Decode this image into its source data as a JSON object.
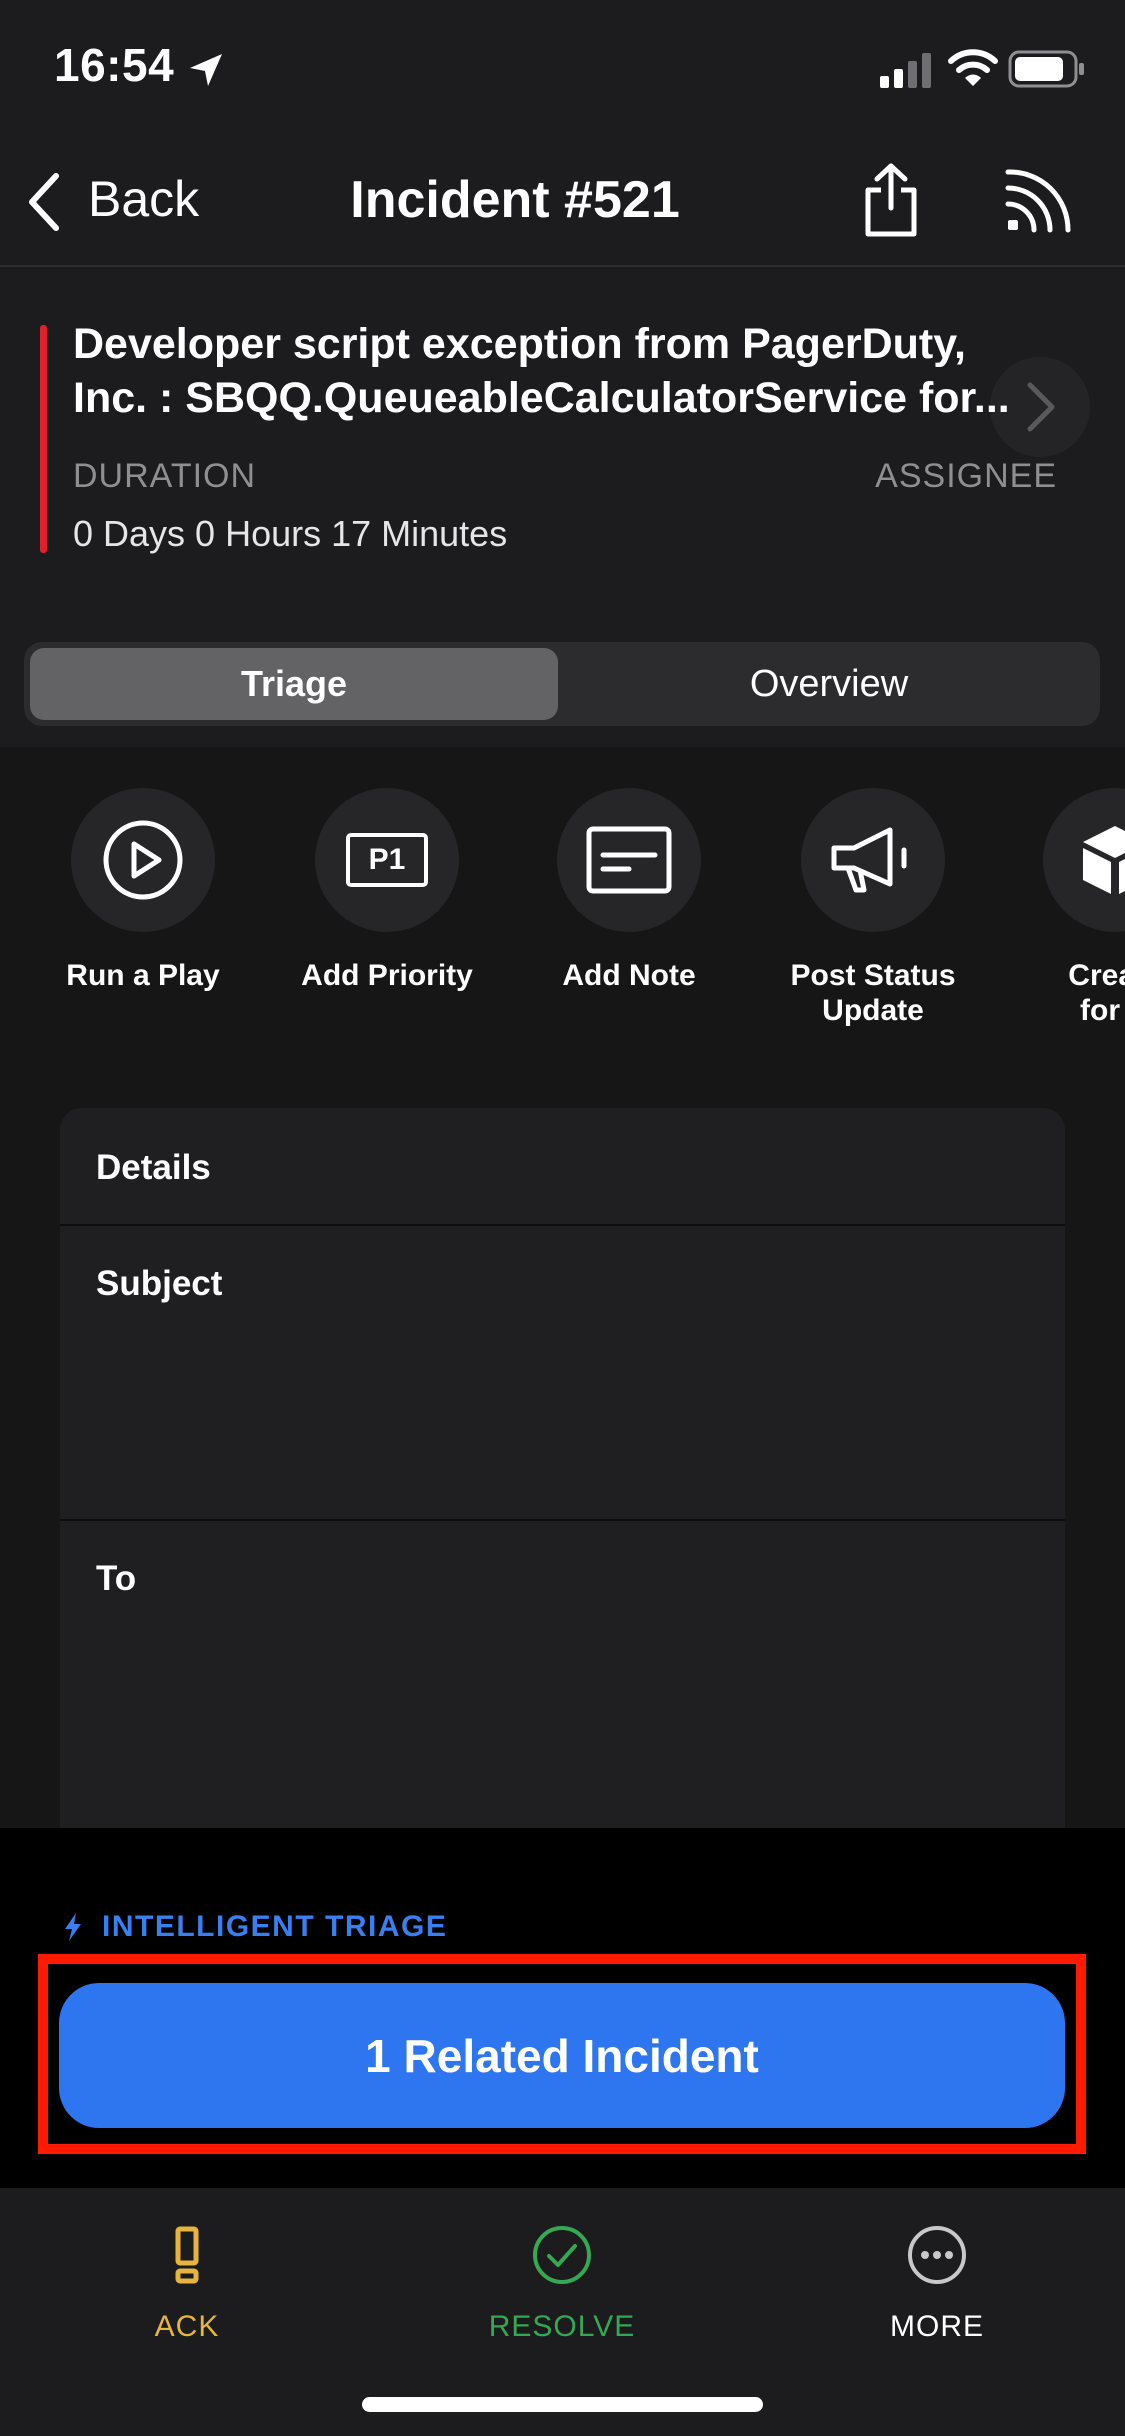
{
  "status_bar": {
    "time": "16:54"
  },
  "nav": {
    "back_label": "Back",
    "title": "Incident #521"
  },
  "incident": {
    "title_line1": "Developer script exception from PagerDuty,",
    "title_line2": "Inc. : SBQQ.QueueableCalculatorService for...",
    "duration_label": "DURATION",
    "assignee_label": "ASSIGNEE",
    "duration_value": "0 Days 0 Hours 17 Minutes"
  },
  "segments": {
    "triage": "Triage",
    "overview": "Overview"
  },
  "actions": [
    {
      "label": "Run a Play"
    },
    {
      "label": "Add Priority",
      "icon_text": "P1"
    },
    {
      "label": "Add Note"
    },
    {
      "label_line1": "Post Status",
      "label_line2": "Update"
    },
    {
      "label_line1": "Create",
      "label_line2": "for B"
    }
  ],
  "details": {
    "header": "Details",
    "subject_label": "Subject",
    "to_label": "To"
  },
  "intelligent_triage": {
    "label": "INTELLIGENT TRIAGE",
    "button_label": "1 Related Incident"
  },
  "tabs": {
    "ack": "ACK",
    "resolve": "RESOLVE",
    "more": "MORE"
  },
  "colors": {
    "ack": "#e6b53e",
    "resolve": "#34a853",
    "accent": "#2e76f0",
    "urgency": "#e0212d",
    "highlight": "#ff1a00"
  }
}
